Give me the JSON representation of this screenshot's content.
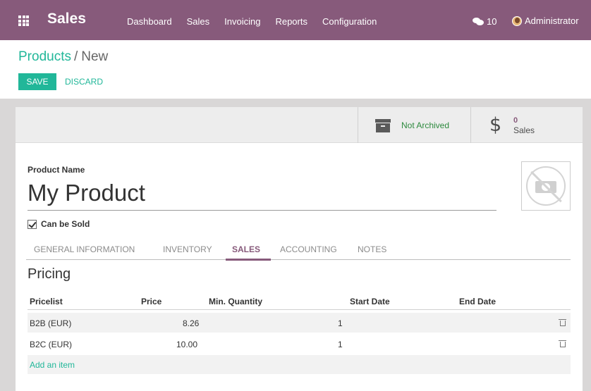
{
  "navbar": {
    "brand": "Sales",
    "menu": [
      "Dashboard",
      "Sales",
      "Invoicing",
      "Reports",
      "Configuration"
    ],
    "chat_count": "10",
    "user": "Administrator",
    "color": "#875a7b"
  },
  "breadcrumb": {
    "parent": "Products",
    "current": "New"
  },
  "buttons": {
    "save": "SAVE",
    "discard": "DISCARD"
  },
  "stat_buttons": {
    "archive": {
      "label": "Not Archived",
      "icon": "archive-icon"
    },
    "sales": {
      "count": "0",
      "label": "Sales",
      "icon": "dollar-icon",
      "symbol": "$"
    }
  },
  "form": {
    "product_name_label": "Product Name",
    "product_name": "My Product",
    "can_be_sold_label": "Can be Sold",
    "can_be_sold": true
  },
  "tabs": [
    "GENERAL INFORMATION",
    "INVENTORY",
    "SALES",
    "ACCOUNTING",
    "NOTES"
  ],
  "active_tab": "SALES",
  "pricing": {
    "title": "Pricing",
    "columns": [
      "Pricelist",
      "Price",
      "Min. Quantity",
      "Start Date",
      "End Date"
    ],
    "rows": [
      {
        "pricelist": "B2B (EUR)",
        "price": "8.26",
        "min_qty": "1",
        "start": "",
        "end": ""
      },
      {
        "pricelist": "B2C (EUR)",
        "price": "10.00",
        "min_qty": "1",
        "start": "",
        "end": ""
      }
    ],
    "add_item": "Add an item"
  },
  "colors": {
    "accent": "#21b799",
    "brand": "#875a7b",
    "archive_text": "#2d8a3e"
  }
}
